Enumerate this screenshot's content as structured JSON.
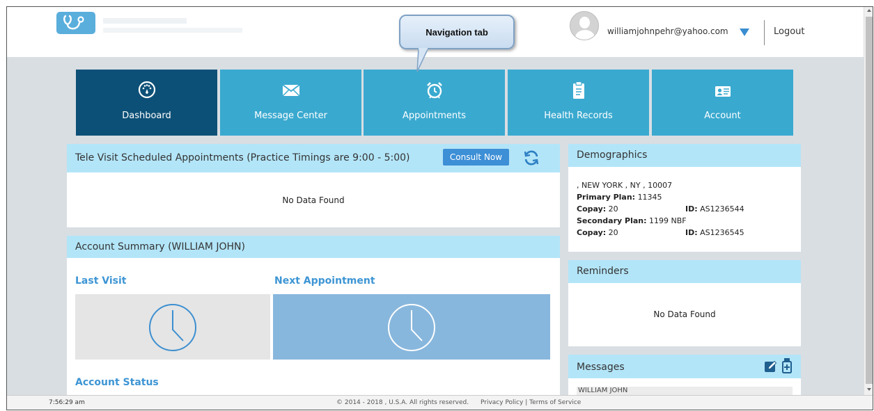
{
  "header": {
    "user_email": "williamjohnpehr@yahoo.com",
    "logout_label": "Logout"
  },
  "callout": {
    "text": "Navigation tab"
  },
  "nav": {
    "tabs": [
      {
        "label": "Dashboard",
        "icon": "dashboard-icon",
        "active": true
      },
      {
        "label": "Message Center",
        "icon": "envelope-icon",
        "active": false
      },
      {
        "label": "Appointments",
        "icon": "alarm-clock-icon",
        "active": false
      },
      {
        "label": "Health Records",
        "icon": "clipboard-icon",
        "active": false
      },
      {
        "label": "Account",
        "icon": "id-card-icon",
        "active": false
      }
    ]
  },
  "televisit": {
    "title": "Tele Visit Scheduled Appointments (Practice Timings are 9:00 - 5:00)",
    "consult_label": "Consult Now",
    "empty_text": "No Data Found"
  },
  "account_summary": {
    "title": "Account Summary (WILLIAM JOHN)",
    "last_visit_label": "Last Visit",
    "next_appointment_label": "Next Appointment",
    "account_status_label": "Account Status"
  },
  "demographics": {
    "title": "Demographics",
    "address": ", NEW YORK , NY , 10007",
    "primary_plan_label": "Primary Plan:",
    "primary_plan_value": "11345",
    "copay1_label": "Copay:",
    "copay1_value": "20",
    "id1_label": "ID:",
    "id1_value": "AS1236544",
    "secondary_plan_label": "Secondary Plan:",
    "secondary_plan_value": "1199 NBF",
    "copay2_label": "Copay:",
    "copay2_value": "20",
    "id2_label": "ID:",
    "id2_value": "AS1236545"
  },
  "reminders": {
    "title": "Reminders",
    "empty_text": "No Data Found"
  },
  "messages": {
    "title": "Messages",
    "first_item": "WILLIAM JOHN"
  },
  "footer": {
    "time": "7:56:29 am",
    "copyright": "© 2014 - 2018 , U.S.A. All rights reserved.",
    "privacy_label": "Privacy Policy",
    "separator": "|",
    "terms_label": "Terms of Service"
  },
  "colors": {
    "nav_tile": "#3aa9cf",
    "nav_active": "#0d5077",
    "panel_header": "#b3e5f8",
    "accent_blue": "#3d95d4"
  }
}
